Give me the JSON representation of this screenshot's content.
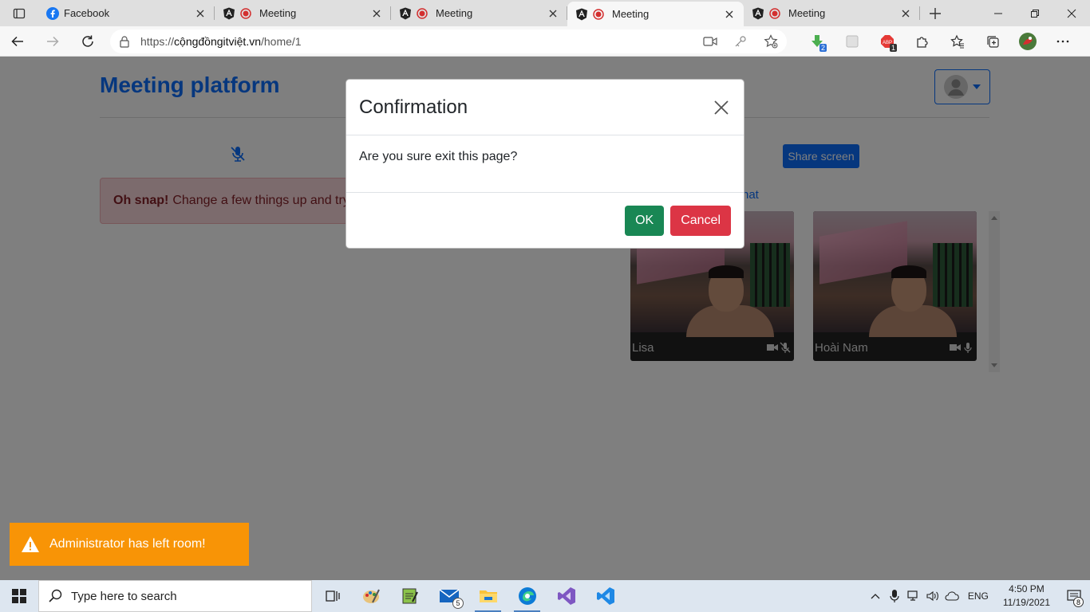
{
  "browser": {
    "tabs": [
      {
        "title": "Facebook",
        "favicon": "facebook-icon",
        "active": false
      },
      {
        "title": "Meeting",
        "favicon": "angular-icon",
        "active": false
      },
      {
        "title": "Meeting",
        "favicon": "angular-icon",
        "active": false
      },
      {
        "title": "Meeting",
        "favicon": "angular-icon",
        "active": true
      },
      {
        "title": "Meeting",
        "favicon": "angular-icon",
        "active": false
      }
    ],
    "address": {
      "scheme": "https://",
      "host": "cộngđồngitviệt.vn",
      "path": "/home/1"
    },
    "extensions": [
      {
        "name": "download-extension-icon",
        "badge": "2"
      },
      {
        "name": "grey-extension-icon",
        "badge": ""
      },
      {
        "name": "adblock-icon",
        "badge": "1"
      },
      {
        "name": "puzzle-icon",
        "badge": ""
      },
      {
        "name": "favorites-icon",
        "badge": ""
      },
      {
        "name": "collections-icon",
        "badge": ""
      },
      {
        "name": "profile-avatar",
        "badge": ""
      },
      {
        "name": "more-icon",
        "badge": ""
      }
    ]
  },
  "page": {
    "brand": "Meeting platform",
    "share_button": "Share screen",
    "alert": {
      "strong": "Oh snap!",
      "text": "Change a few things up and try submitting again."
    },
    "chat_link": "hat",
    "participants": [
      {
        "name": "Lisa",
        "camera": "on",
        "mic": "off"
      },
      {
        "name": "Hoài Nam",
        "camera": "on",
        "mic": "on"
      }
    ]
  },
  "modal": {
    "title": "Confirmation",
    "body": "Are you sure exit this page?",
    "ok_label": "OK",
    "cancel_label": "Cancel"
  },
  "toast": {
    "message": "Administrator has left room!"
  },
  "taskbar": {
    "search_placeholder": "Type here to search",
    "mail_count": "5",
    "lang": "ENG",
    "time": "4:50 PM",
    "date": "11/19/2021",
    "notifications": "8"
  },
  "colors": {
    "primary": "#0d6efd",
    "success": "#198754",
    "danger": "#dc3545",
    "toast": "#f89406"
  }
}
